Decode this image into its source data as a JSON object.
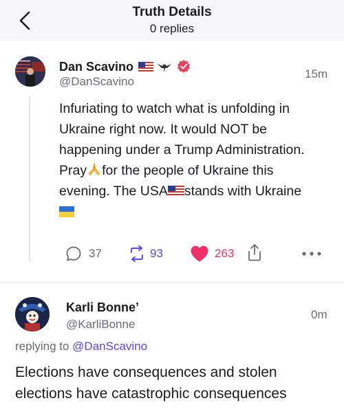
{
  "header": {
    "title": "Truth Details",
    "subtitle": "0 replies"
  },
  "post": {
    "display_name": "Dan Scavino",
    "handle": "@DanScavino",
    "time": "15m",
    "body": {
      "line1": "Infuriating to watch what is unfolding in",
      "line2": "Ukraine right now. It would NOT be",
      "line3": "happening under a Trump Administration.",
      "line4_a": "Pray",
      "line4_b": "for the people of Ukraine this",
      "line5": "evening. The USA",
      "line5_b": "stands with Ukraine"
    },
    "actions": {
      "replies": "37",
      "retruths": "93",
      "likes": "263"
    },
    "colors": {
      "like": "#f0306a",
      "retruth": "#5448ee",
      "verified": "#e8425b"
    }
  },
  "reply": {
    "display_name": "Karli Bonne’",
    "handle": "@KarliBonne",
    "time": "0m",
    "replying_prefix": "replying to",
    "replying_handle": "@DanScavino",
    "body_line1": "Elections have consequences and stolen",
    "body_line2": "elections have catastrophic consequences"
  },
  "icons": [
    "back-chevron-icon",
    "us-flag-icon",
    "eagle-icon",
    "verified-badge-icon",
    "reply-icon",
    "retruth-icon",
    "heart-icon",
    "share-icon",
    "more-icon",
    "praying-hands-icon",
    "ukraine-flag-icon"
  ]
}
